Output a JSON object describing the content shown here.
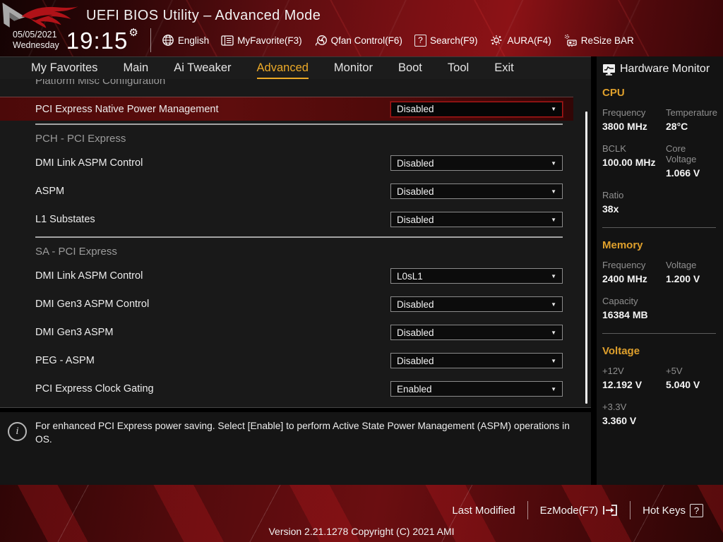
{
  "header": {
    "title": "UEFI BIOS Utility – Advanced Mode",
    "date": "05/05/2021",
    "weekday": "Wednesday",
    "time": "19:15",
    "toolbar": [
      {
        "icon": "globe-icon",
        "label": "English"
      },
      {
        "icon": "myfavorite-icon",
        "label": "MyFavorite(F3)"
      },
      {
        "icon": "qfan-icon",
        "label": "Qfan Control(F6)"
      },
      {
        "icon": "question-box-icon",
        "label": "Search(F9)"
      },
      {
        "icon": "aura-icon",
        "label": "AURA(F4)"
      },
      {
        "icon": "resize-bar-icon",
        "label": "ReSize BAR"
      }
    ]
  },
  "nav": {
    "tabs": [
      {
        "label": "My Favorites",
        "active": false
      },
      {
        "label": "Main",
        "active": false
      },
      {
        "label": "Ai Tweaker",
        "active": false
      },
      {
        "label": "Advanced",
        "active": true
      },
      {
        "label": "Monitor",
        "active": false
      },
      {
        "label": "Boot",
        "active": false
      },
      {
        "label": "Tool",
        "active": false
      },
      {
        "label": "Exit",
        "active": false
      }
    ]
  },
  "content": {
    "clipped_header": "Platform Misc Configuration",
    "rows": [
      {
        "type": "setting",
        "label": "PCI Express Native Power Management",
        "value": "Disabled",
        "selected": true
      },
      {
        "type": "divider"
      },
      {
        "type": "section",
        "label": "PCH - PCI Express"
      },
      {
        "type": "setting",
        "label": "DMI Link ASPM Control",
        "value": "Disabled",
        "selected": false
      },
      {
        "type": "setting",
        "label": "ASPM",
        "value": "Disabled",
        "selected": false
      },
      {
        "type": "setting",
        "label": "L1 Substates",
        "value": "Disabled",
        "selected": false
      },
      {
        "type": "divider"
      },
      {
        "type": "section",
        "label": "SA - PCI Express"
      },
      {
        "type": "setting",
        "label": "DMI Link ASPM Control",
        "value": "L0sL1",
        "selected": false
      },
      {
        "type": "setting",
        "label": "DMI Gen3 ASPM Control",
        "value": "Disabled",
        "selected": false
      },
      {
        "type": "setting",
        "label": "DMI Gen3 ASPM",
        "value": "Disabled",
        "selected": false
      },
      {
        "type": "setting",
        "label": "PEG - ASPM",
        "value": "Disabled",
        "selected": false
      },
      {
        "type": "setting",
        "label": "PCI Express Clock Gating",
        "value": "Enabled",
        "selected": false
      }
    ],
    "help_text": "For enhanced PCI Express power saving. Select [Enable] to perform Active State Power Management (ASPM) operations in OS."
  },
  "hardware_monitor": {
    "title": "Hardware Monitor",
    "sections": [
      {
        "title": "CPU",
        "metrics": [
          {
            "label": "Frequency",
            "value": "3800 MHz"
          },
          {
            "label": "Temperature",
            "value": "28°C"
          },
          {
            "label": "BCLK",
            "value": "100.00 MHz"
          },
          {
            "label": "Core Voltage",
            "value": "1.066 V"
          },
          {
            "label": "Ratio",
            "value": "38x"
          }
        ]
      },
      {
        "title": "Memory",
        "metrics": [
          {
            "label": "Frequency",
            "value": "2400 MHz"
          },
          {
            "label": "Voltage",
            "value": "1.200 V"
          },
          {
            "label": "Capacity",
            "value": "16384 MB"
          }
        ]
      },
      {
        "title": "Voltage",
        "metrics": [
          {
            "label": "+12V",
            "value": "12.192 V"
          },
          {
            "label": "+5V",
            "value": "5.040 V"
          },
          {
            "label": "+3.3V",
            "value": "3.360 V"
          }
        ]
      }
    ]
  },
  "footer": {
    "last_modified": "Last Modified",
    "ezmode": "EzMode(F7)",
    "hot_keys": "Hot Keys",
    "hot_keys_badge": "?",
    "version": "Version 2.21.1278 Copyright (C) 2021 AMI"
  },
  "colors": {
    "accent_gold": "#edaa28",
    "selected_row_red": "#5e0d0d",
    "selected_border_red": "#b01616",
    "hw_section_gold": "#dfa02c"
  }
}
